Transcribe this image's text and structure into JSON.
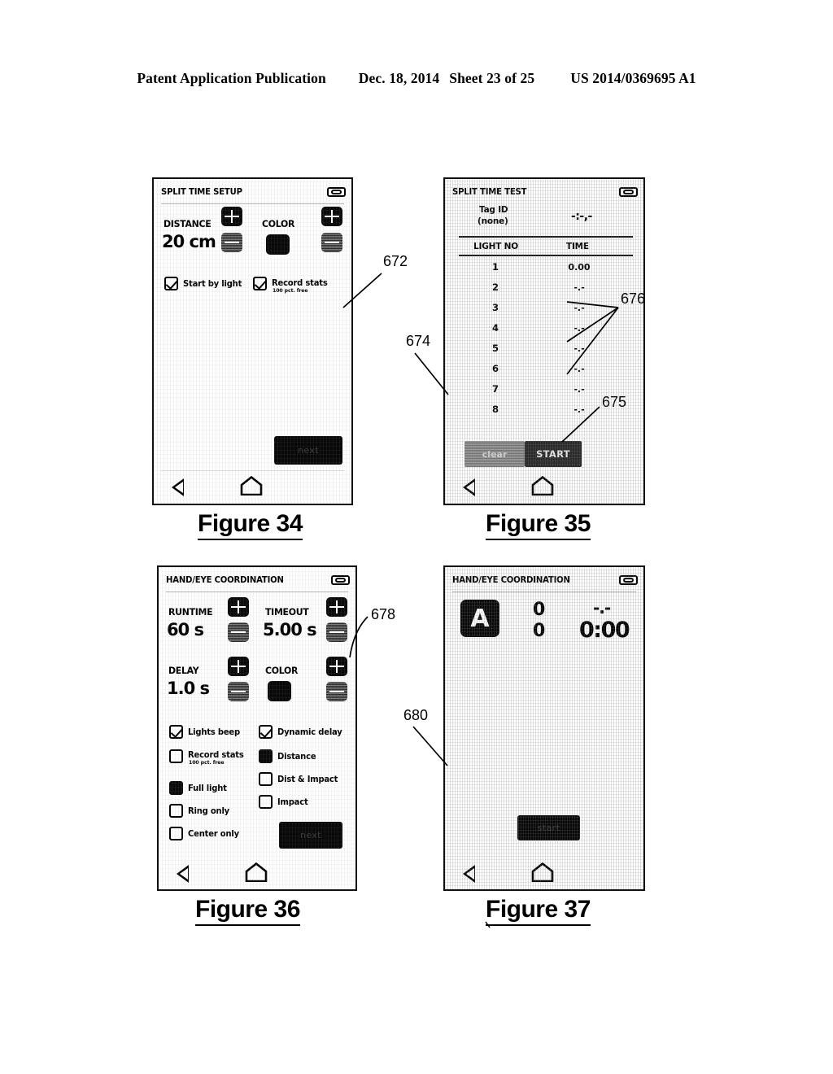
{
  "header": {
    "publication": "Patent Application Publication",
    "date": "Dec. 18, 2014",
    "sheet": "Sheet 23 of 25",
    "number": "US 2014/0369695 A1"
  },
  "figures": [
    {
      "id": "fig34",
      "caption": "Figure 34"
    },
    {
      "id": "fig35",
      "caption": "Figure 35"
    },
    {
      "id": "fig36",
      "caption": "Figure 36"
    },
    {
      "id": "fig37",
      "caption": "Figure 37"
    }
  ],
  "reference_numerals": [
    {
      "label": "672"
    },
    {
      "label": "674"
    },
    {
      "label": "675"
    },
    {
      "label": "676"
    },
    {
      "label": "678"
    },
    {
      "label": "680"
    }
  ],
  "fig34": {
    "title": "SPLIT TIME SETUP",
    "battery_icon": "battery-charging-icon",
    "distance": {
      "label": "DISTANCE",
      "value": "20 cm",
      "plus": "+",
      "minus": "-"
    },
    "color": {
      "label": "COLOR",
      "swatch": "#080808",
      "plus": "+",
      "minus": "-"
    },
    "checkboxes": [
      {
        "label": "Start by light",
        "sub": "",
        "state": "checked"
      },
      {
        "label": "Record stats",
        "sub": "100 pct. free",
        "state": "checked"
      }
    ],
    "next_button": "next",
    "nav": {
      "back": "back-icon",
      "home": "home-icon"
    }
  },
  "fig35": {
    "title": "SPLIT TIME TEST",
    "battery_icon": "battery-charging-icon",
    "tag_id_label": "Tag ID",
    "tag_id_value": "(none)",
    "tag_time": "-:-,-",
    "columns": [
      "LIGHT NO",
      "TIME"
    ],
    "rows": [
      {
        "light_no": "1",
        "time": "0.00"
      },
      {
        "light_no": "2",
        "time": "-.-"
      },
      {
        "light_no": "3",
        "time": "-.-"
      },
      {
        "light_no": "4",
        "time": "-.-"
      },
      {
        "light_no": "5",
        "time": "-.-"
      },
      {
        "light_no": "6",
        "time": "-.-"
      },
      {
        "light_no": "7",
        "time": "-.-"
      },
      {
        "light_no": "8",
        "time": "-.-"
      }
    ],
    "clear_button": "clear",
    "start_button": "START",
    "nav": {
      "back": "back-icon",
      "home": "home-icon"
    }
  },
  "fig36": {
    "title": "HAND/EYE COORDINATION",
    "battery_icon": "battery-charging-icon",
    "runtime": {
      "label": "RUNTIME",
      "value": "60 s"
    },
    "timeout": {
      "label": "TIMEOUT",
      "value": "5.00 s"
    },
    "delay": {
      "label": "DELAY",
      "value": "1.0 s"
    },
    "color": {
      "label": "COLOR",
      "swatch": "#080808"
    },
    "checkboxes_left": [
      {
        "label": "Lights beep",
        "sub": "",
        "state": "checked"
      },
      {
        "label": "Record stats",
        "sub": "100 pct. free",
        "state": "unchecked"
      },
      {
        "label": "Full light",
        "sub": "",
        "state": "filled"
      },
      {
        "label": "Ring only",
        "sub": "",
        "state": "unchecked"
      },
      {
        "label": "Center only",
        "sub": "",
        "state": "unchecked"
      }
    ],
    "checkboxes_right": [
      {
        "label": "Dynamic delay",
        "sub": "",
        "state": "checked"
      },
      {
        "label": "Distance",
        "sub": "",
        "state": "filled"
      },
      {
        "label": "Dist & Impact",
        "sub": "",
        "state": "unchecked"
      },
      {
        "label": "Impact",
        "sub": "",
        "state": "unchecked"
      }
    ],
    "next_button": "next",
    "nav": {
      "back": "back-icon",
      "home": "home-icon"
    }
  },
  "fig37": {
    "title": "HAND/EYE COORDINATION",
    "battery_icon": "battery-charging-icon",
    "letter_badge": "A",
    "score_top": "0",
    "score_bottom": "0",
    "split_display": "-.-",
    "clock_display": "0:00",
    "action_button": "start",
    "nav": {
      "back": "back-icon",
      "home": "home-icon"
    }
  }
}
